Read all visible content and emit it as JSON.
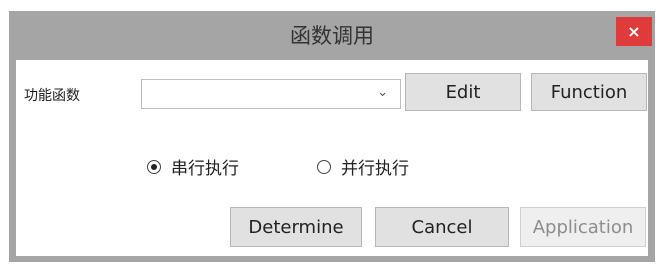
{
  "window": {
    "title": "函数调用",
    "close_label": "×"
  },
  "form": {
    "function_label": "功能函数",
    "function_value": "",
    "dropdown_icon": "chevron-down-icon"
  },
  "buttons": {
    "edit": "Edit",
    "function": "Function",
    "determine": "Determine",
    "cancel": "Cancel",
    "application": "Application"
  },
  "execution_mode": {
    "options": [
      {
        "label": "串行执行",
        "checked": true
      },
      {
        "label": "并行执行",
        "checked": false
      }
    ]
  },
  "colors": {
    "titlebar": "#a5a5a5",
    "close": "#e03b3b",
    "button_face": "#e1e1e1"
  }
}
